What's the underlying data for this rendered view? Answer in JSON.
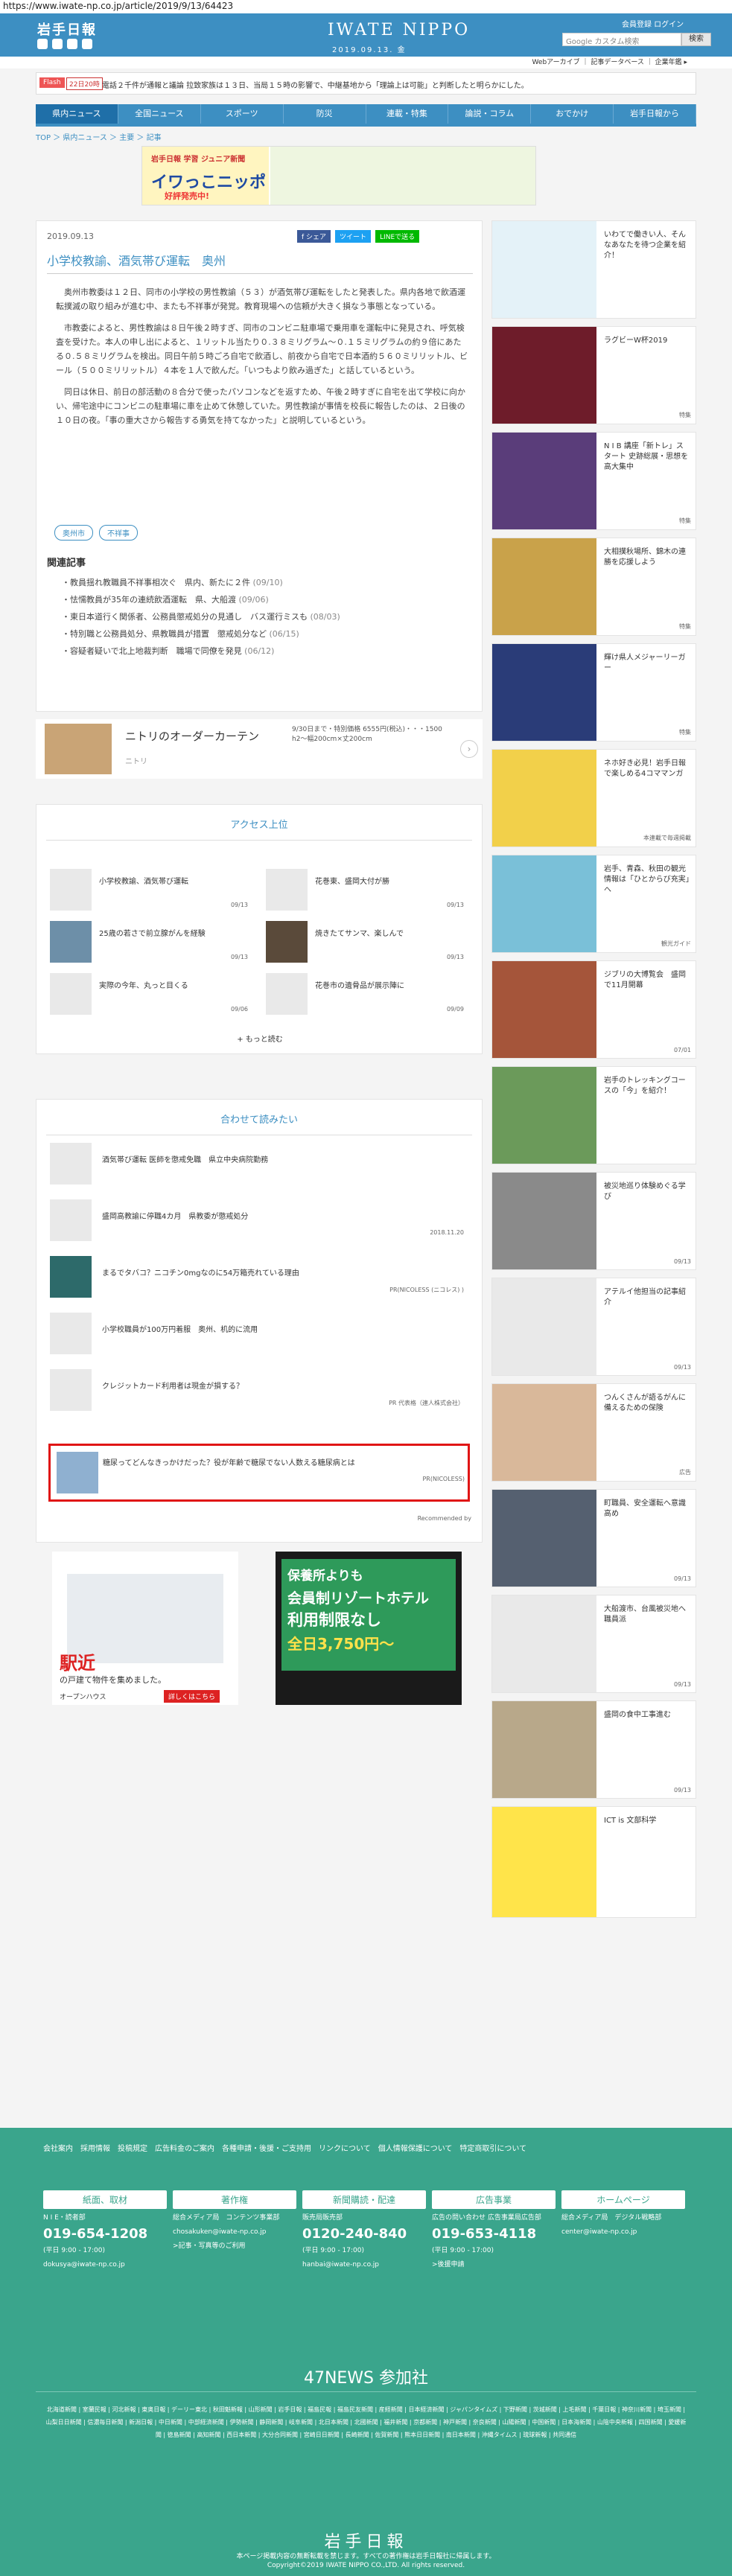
{
  "url": "https://www.iwate-np.co.jp/article/2019/9/13/64423",
  "header": {
    "logo": "岩手日報",
    "brand": "IWATE NIPPO",
    "date": "2019.09.13. 金",
    "member": "会員登録 ログイン",
    "search_placeholder": "Google カスタム検索",
    "search_button": "検索"
  },
  "sublinks": "Webアーカイブ ｜ 記事データベース ｜ 企業年鑑 ▸",
  "flash": {
    "tag": "Flash",
    "time": "22日20時",
    "text": "電話２千件が通報と議論 拉致家族は１３日、当局１５時の影響で、中継基地から「理論上は可能」と判断したと明らかにした。"
  },
  "nav": [
    "県内ニュース",
    "全国ニュース",
    "スポーツ",
    "防災",
    "連載・特集",
    "論説・コラム",
    "おでかけ",
    "岩手日報から"
  ],
  "breadcrumb": "TOP ＞ 県内ニュース ＞ 主要 ＞ 記事",
  "banner": {
    "top": "岩手日報 学習 ジュニア新聞",
    "title": "イワっこニッポ",
    "sub": "好評発売中!"
  },
  "article": {
    "date": "2019.09.13",
    "title": "小学校教諭、酒気帯び運転　奥州",
    "share": [
      "f シェア",
      "ツイート",
      "LINEで送る"
    ],
    "paragraphs": [
      "奥州市教委は１２日、同市の小学校の男性教諭（５３）が酒気帯び運転をしたと発表した。県内各地で飲酒運転撲滅の取り組みが進む中、またも不祥事が発覚。教育現場への信頼が大きく損なう事態となっている。",
      "市教委によると、男性教諭は８日午後２時すぎ、同市のコンビニ駐車場で乗用車を運転中に発見され、呼気検査を受けた。本人の申し出によると、１リットル当たり０.３８ミリグラム～０.１５ミリグラムの約９倍にあたる０.５８ミリグラムを検出。同日午前５時ごろ自宅で飲酒し、前夜から自宅で日本酒約５６０ミリリットル、ビール（５００ミリリットル）４本を１人で飲んだ。「いつもより飲み過ぎた」と話しているという。",
      "同日は休日、前日の部活動の８合分で使ったパソコンなどを返すため、午後２時すぎに自宅を出て学校に向かい、帰宅途中にコンビニの駐車場に車を止めて休憩していた。男性教諭が事情を校長に報告したのは、２日後の１０日の夜。「事の重大さから報告する勇気を持てなかった」と説明しているという。"
    ],
    "tags": [
      "奥州市",
      "不祥事"
    ],
    "related_title": "関連記事",
    "related": [
      {
        "t": "教員揺れ教職員不祥事相次ぐ　県内、新たに２件",
        "d": "(09/10)"
      },
      {
        "t": "怯懦教員が35年の連続飲酒運転　県、大船渡",
        "d": "(09/06)"
      },
      {
        "t": "東日本道行く関係者、公務員懲戒処分の見通し　バス運行ミスも",
        "d": "(08/03)"
      },
      {
        "t": "特別職と公務員処分、県教職員が措置　懲戒処分など",
        "d": "(06/15)"
      },
      {
        "t": "容疑者疑いで北上地裁判断　職場で同僚を発見",
        "d": "(06/12)"
      }
    ]
  },
  "native_ad": {
    "title": "ニトリのオーダーカーテン",
    "sponsor": "ニトリ",
    "right": "9/30日まで・特別価格 6555円(税込)・・・1500 h2〜幅200cm×丈200cm"
  },
  "ranking": {
    "title": "アクセス上位",
    "more": "+ もっと読む",
    "items": [
      {
        "t": "小学校教諭、酒気帯び運転",
        "d": "09/13"
      },
      {
        "t": "花巻東、盛岡大付が勝",
        "d": "09/13"
      },
      {
        "t": "25歳の若さで前立腺がんを経験",
        "d": "09/13"
      },
      {
        "t": "焼きたてサンマ、楽しんで",
        "d": "09/13"
      },
      {
        "t": "実際の今年、丸っと目くる",
        "d": "09/06"
      },
      {
        "t": "花巻市の遺骨品が展示陣に",
        "d": "09/09"
      }
    ]
  },
  "reco": {
    "title": "合わせて読みたい",
    "by": "Recommended by",
    "items": [
      {
        "t": "酒気帯び運転 医師を懲戒免職　県立中央病院勤務",
        "s": ""
      },
      {
        "t": "盛岡高教諭に停職4カ月　県教委が懲戒処分",
        "s": "2018.11.20"
      },
      {
        "t": "まるでタバコ？ニコチン0mgなのに54万箱売れている理由",
        "s": "PR(NICOLESS (ニコレス) )"
      },
      {
        "t": "小学校職員が100万円着服　奥州、机的に流用",
        "s": ""
      },
      {
        "t": "クレジットカード利用者は現金が損する？",
        "s": "PR 代表格（連人株式会社）"
      },
      {
        "t": "糖尿ってどんなきっかけだった？役が年齢で糖尿でない人数える糖尿病とは",
        "s": "PR(NICOLESS)"
      }
    ]
  },
  "ad1": {
    "title": "駅近",
    "sub": "の戸建て物件を集めました。",
    "brand": "オープンハウス",
    "btn": "詳しくはこちら"
  },
  "ad2": {
    "lines": [
      "保養所よりも",
      "会員制リゾートホテル",
      "利用制限なし",
      "全日3,750円〜"
    ]
  },
  "side": [
    {
      "t": "いわてで働きい人、そんなあなたを待つ企業を紹介！",
      "m": ""
    },
    {
      "t": "ラグビーW杯2019",
      "m": "特集"
    },
    {
      "t": "N I B 講座「新トレ」スタート 史跡総展・思想を高大集中",
      "m": "特集"
    },
    {
      "t": "大相撲秋場所、錦木の連勝を応援しよう",
      "m": "特集"
    },
    {
      "t": "輝け県人メジャーリーガー",
      "m": "特集"
    },
    {
      "t": "ネホ好き必見！岩手日報で楽しめる4コママンガ",
      "m": "本連載で毎週掲載"
    },
    {
      "t": "岩手、青森、秋田の観光情報は「ひとからび充実」へ",
      "m": "観光ガイド"
    },
    {
      "t": "ジブリの大博覧会　盛岡で11月開幕",
      "m": "07/01"
    },
    {
      "t": "岩手のトレッキングコースの「今」を紹介！",
      "m": ""
    },
    {
      "t": "被災地巡り体験めぐる学び",
      "m": "09/13"
    },
    {
      "t": "アテルイ他担当の記事紹介",
      "m": "09/13"
    },
    {
      "t": "つんくさんが語るがんに備えるための保険",
      "m": "広告"
    },
    {
      "t": "町職員、安全運転へ意識高め",
      "m": "09/13"
    },
    {
      "t": "大船渡市、台風被災地へ職員派",
      "m": "09/13"
    },
    {
      "t": "盛岡の食中工事進む",
      "m": "09/13"
    },
    {
      "t": "ICT is 文部科学",
      "m": ""
    }
  ],
  "footer": {
    "links": "会社案内　採用情報　投稿規定　広告料金のご案内　各種申請・後援・ご支持用　リンクについて　個人情報保護について　特定商取引について",
    "cols": [
      {
        "h": "紙面、取材",
        "c": "N I E・読者部",
        "p": "019-654-1208",
        "c2": "(平日 9:00 - 17:00)",
        "e": "dokusya@iwate-np.co.jp"
      },
      {
        "h": "著作権",
        "c": "総合メディア局　コンテンツ事業部",
        "p": "",
        "c2": "chosakuken@iwate-np.co.jp",
        "e": ">記事・写真等のご利用"
      },
      {
        "h": "新聞購読・配達",
        "c": "販売局販売部",
        "p": "0120-240-840",
        "c2": "(平日 9:00 - 17:00)",
        "e": "hanbai@iwate-np.co.jp"
      },
      {
        "h": "広告事業",
        "c": "広告の問い合わせ 広告事業局広告部",
        "p": "019-653-4118",
        "c2": "(平日 9:00 - 17:00)",
        "e": ">後援申請"
      },
      {
        "h": "ホームページ",
        "c": "総合メディア局　デジタル戦略部",
        "p": "",
        "c2": "center@iwate-np.co.jp",
        "e": ""
      }
    ],
    "n47": "47NEWS 参加社",
    "n47list": "北海道新聞 | 室蘭民報 | 河北新報 | 東奥日報 | デーリー東北 | 秋田魁新報 | 山形新聞 | 岩手日報 | 福島民報 | 福島民友新聞 | 産経新聞 | 日本経済新聞 | ジャパンタイムズ | 下野新聞 | 茨城新聞 | 上毛新聞 | 千葉日報 | 神奈川新聞 | 埼玉新聞 | 山梨日日新聞 | 信濃毎日新聞 | 新潟日報 | 中日新聞 | 中部経済新聞 | 伊勢新聞 | 静岡新聞 | 岐阜新聞 | 北日本新聞 | 北國新聞 | 福井新聞 | 京都新聞 | 神戸新聞 | 奈良新聞 | 山陽新聞 | 中国新聞 | 日本海新聞 | 山陰中央新報 | 四国新聞 | 愛媛新聞 | 徳島新聞 | 高知新聞 | 西日本新聞 | 大分合同新聞 | 宮崎日日新聞 | 長崎新聞 | 佐賀新聞 | 熊本日日新聞 | 南日本新聞 | 沖縄タイムス | 琉球新報 | 共同通信",
    "logo": "岩手日報",
    "copy1": "本ページ掲載内容の無断転載を禁じます。すべての著作権は岩手日報社に帰属します。",
    "copy2": "Copyright©2019 IWATE NIPPO CO.,LTD. All rights reserved."
  }
}
